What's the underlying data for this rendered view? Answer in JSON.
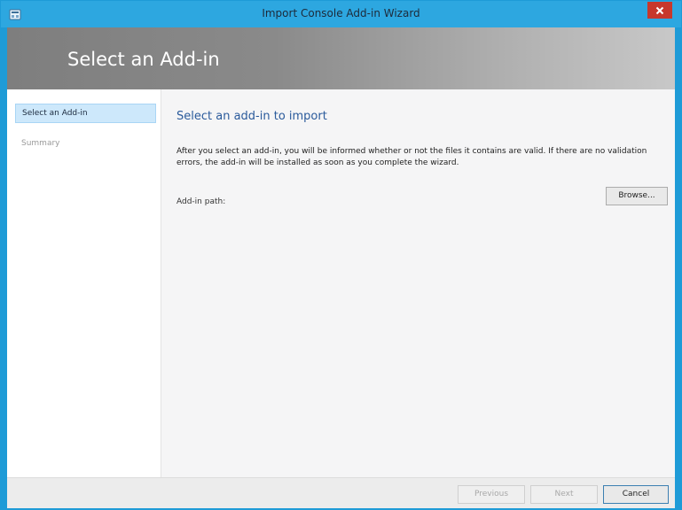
{
  "window": {
    "title": "Import Console Add-in Wizard"
  },
  "banner": {
    "title": "Select an Add-in"
  },
  "sidebar": {
    "items": [
      {
        "label": "Select an Add-in",
        "active": true
      },
      {
        "label": "Summary",
        "active": false
      }
    ]
  },
  "main": {
    "heading": "Select an add-in to import",
    "description": "After you select an add-in, you will be informed whether or not the files it contains are valid. If there are no validation errors, the add-in will be installed as soon as you complete the wizard.",
    "path_label": "Add-in path:",
    "path_value": "",
    "browse_label": "Browse..."
  },
  "footer": {
    "previous_label": "Previous",
    "next_label": "Next",
    "cancel_label": "Cancel"
  },
  "colors": {
    "titlebar": "#2da7e0",
    "close": "#c7382c",
    "heading": "#2a5a9b",
    "nav_active": "#cde8fb"
  },
  "icons": {
    "app": "console-app-icon",
    "close": "close-icon"
  }
}
